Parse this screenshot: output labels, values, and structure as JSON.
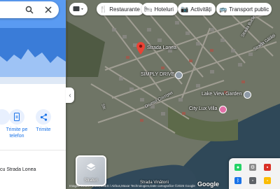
{
  "sidebar": {
    "actions": [
      {
        "label_line1": "",
        "label_line2": "",
        "icon": "partial-action-icon"
      },
      {
        "label_line1": "Trimite pe",
        "label_line2": "telefon",
        "icon": "phone-send-icon"
      },
      {
        "label_line1": "Trimite",
        "label_line2": "",
        "icon": "share-icon"
      }
    ],
    "nearby_text": "cu Strada Lonea"
  },
  "chips": [
    {
      "label": "Restaurante",
      "icon": "restaurant-icon"
    },
    {
      "label": "Hoteluri",
      "icon": "hotel-icon"
    },
    {
      "label": "Activități",
      "icon": "camera-icon"
    },
    {
      "label": "Transport public",
      "icon": "bus-icon"
    }
  ],
  "map": {
    "pin_label": "Strada Lonea",
    "places": {
      "simply_drive": "SIMPLY DRIVE",
      "lake_view": "Lake View Garden",
      "city_lux": "City Lux Villa"
    },
    "streets": {
      "s1": "Strada Bucle",
      "s2": "Strada Gălății",
      "s3": "Drumul Cocriștei",
      "s4": "Str."
    },
    "layers_label": "Straturi",
    "footer": "Imagini ©2026 Airbus,CNES / Airbus,Maxar Technologies,Date cartografice ©2026 Google",
    "google_logo": "Google",
    "partial_bottom_text": "Strada Vinătorii",
    "accent_color": "#1a73e8",
    "pin_color": "#ea4335"
  }
}
